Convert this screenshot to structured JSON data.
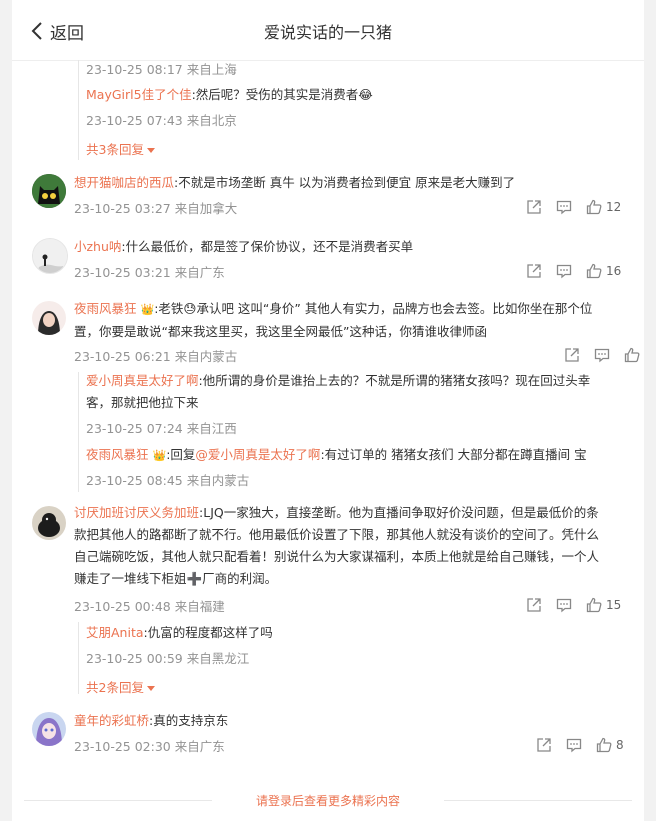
{
  "header": {
    "back_label": "返回",
    "title": "爱说实话的一只猪"
  },
  "c0": {
    "r1_meta": "23-10-25 08:17 来自上海",
    "r2_name": "MayGirl5佳了个佳",
    "r2_text": ":然后呢？受伤的其实是消费者",
    "r2_emoji": "😂",
    "r2_meta": "23-10-25 07:43 来自北京",
    "more": "共3条回复"
  },
  "c1": {
    "name": "想开猫咖店的西瓜",
    "text": ":不就是市场垄断 真牛 以为消费者捡到便宜  原来是老大赚到了",
    "meta": "23-10-25 03:27 来自加拿大",
    "likes": "12"
  },
  "c2": {
    "name": "小zhu呐",
    "text": ":什么最低价，都是签了保价协议，还不是消费者买单",
    "meta": "23-10-25 03:21 来自广东",
    "likes": "16"
  },
  "c3": {
    "name": "夜雨风暴狂",
    "badge": "👑",
    "text1": ":老铁",
    "emoji": "😓",
    "text2": "承认吧 这叫“身价” 其他人有实力，品牌方也会去签。比如你坐在那个位",
    "line2": "置，你要是敢说“都来我这里买，我这里全网最低”这种话，你猜谁收律师函",
    "meta": "23-10-25 06:21 来自内蒙古",
    "r1_name": "爱小周真是太好了啊",
    "r1_text": ":他所谓的身价是谁抬上去的？不就是所谓的猪猪女孩吗？现在回过头幸",
    "r1_line2": "客，那就把他拉下来",
    "r1_meta": "23-10-25 07:24 来自江西",
    "r2_name": "夜雨风暴狂",
    "r2_badge": "👑",
    "r2_text1": ":回复",
    "r2_at": "@爱小周真是太好了啊",
    "r2_text2": ":有过订单的 猪猪女孩们  大部分都在蹲直播间 宝",
    "r2_meta": "23-10-25 08:45 来自内蒙古"
  },
  "c4": {
    "name": "讨厌加班讨厌义务加班",
    "text": ":LJQ一家独大，直接垄断。他为直播间争取好价没问题，但是最低价的条",
    "line2": "款把其他人的路都断了就不行。他用最低价设置了下限，那其他人就没有谈价的空间了。凭什么",
    "line3": "自己端碗吃饭，其他人就只配看着！别说什么为大家谋福利，本质上他就是给自己赚钱，一个人",
    "line4a": "赚走了一堆线下柜姐",
    "plus": "➕",
    "line4b": "厂商的利润。",
    "meta": "23-10-25 00:48 来自福建",
    "likes": "15",
    "r1_name": "艾朋Anita",
    "r1_text": ":仇富的程度都这样了吗",
    "r1_meta": "23-10-25 00:59 来自黑龙江",
    "more": "共2条回复"
  },
  "c5": {
    "name": "童年的彩虹桥",
    "text": ":真的支持京东",
    "meta": "23-10-25 02:30 来自广东",
    "likes": "8"
  },
  "footer": {
    "label": "请登录后查看更多精彩内容"
  },
  "colors": {
    "accent": "#eb7350",
    "meta": "#939393",
    "text": "#333333"
  }
}
